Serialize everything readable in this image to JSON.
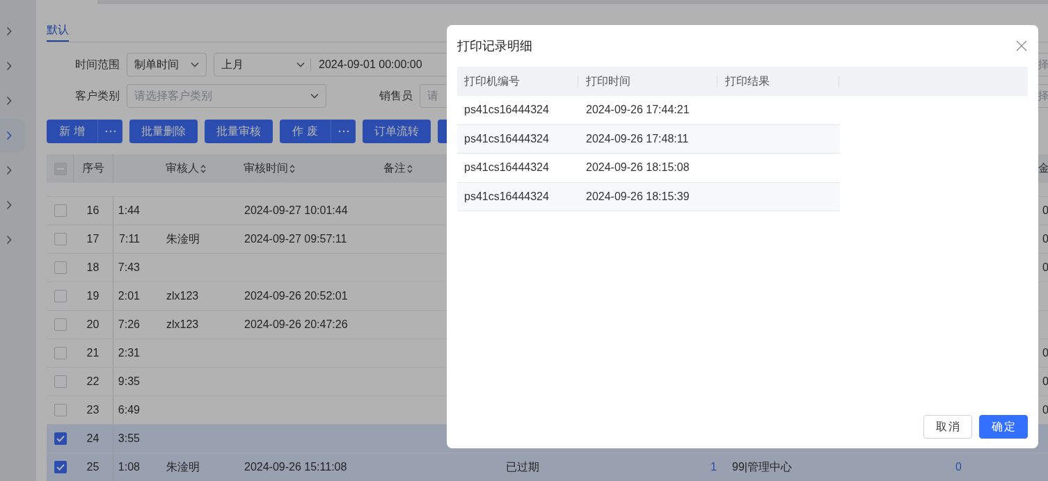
{
  "sidebar": {
    "items": [
      {
        "selected": false
      },
      {
        "selected": false
      },
      {
        "selected": false
      },
      {
        "selected": true
      },
      {
        "selected": false
      },
      {
        "selected": false
      },
      {
        "selected": false
      }
    ]
  },
  "tabs": [
    {
      "label": "默认",
      "selected": true
    }
  ],
  "filters": [
    {
      "kind": "time_range",
      "label": "时间范围",
      "field": "制单时间",
      "period": "上月",
      "date_from": "2024-09-01 00:00:00",
      "edge_placeholder": "择"
    },
    {
      "kind": "select_pair",
      "label": "客户类别",
      "placeholder": "请选择客户类别",
      "label_2": "销售员",
      "placeholder_2": "请",
      "edge_placeholder": "择"
    }
  ],
  "toolbar": [
    {
      "label": "新 增",
      "more": true
    },
    {
      "label": "批量删除",
      "more": false
    },
    {
      "label": "批量审核",
      "more": false
    },
    {
      "label": "作 废",
      "more": true
    },
    {
      "label": "订单流转",
      "more": false
    },
    {
      "more": false
    }
  ],
  "table": {
    "all_checked": false,
    "indeterminate": true,
    "columns": [
      {
        "label": "序号"
      },
      null,
      {
        "label": "审核人",
        "sortable": true
      },
      {
        "label": "审核时间",
        "sortable": true
      },
      {
        "label": "备注",
        "sortable": true
      },
      null,
      null,
      null,
      null,
      null,
      {
        "label": "金"
      }
    ],
    "rows": [
      {
        "selected": false,
        "cells": [
          "16",
          "1:44",
          null,
          "2024-09-27 10:01:44",
          null,
          null,
          null,
          null,
          null,
          null,
          "0"
        ]
      },
      {
        "selected": false,
        "cells": [
          "17",
          "7:11",
          "朱淦明",
          "2024-09-27 09:57:11",
          null,
          null,
          null,
          null,
          null,
          null,
          "0"
        ]
      },
      {
        "selected": false,
        "cells": [
          "18",
          "7:43",
          null,
          null,
          null,
          null,
          null,
          null,
          null,
          null,
          "0"
        ]
      },
      {
        "selected": false,
        "cells": [
          "19",
          "2:01",
          "zlx123",
          "2024-09-26 20:52:01",
          null,
          null,
          null,
          null,
          null,
          null,
          null
        ]
      },
      {
        "selected": false,
        "cells": [
          "20",
          "7:26",
          "zlx123",
          "2024-09-26 20:47:26",
          null,
          null,
          null,
          null,
          null,
          null,
          null
        ]
      },
      {
        "selected": false,
        "cells": [
          "21",
          "2:31",
          null,
          null,
          null,
          null,
          null,
          null,
          null,
          null,
          "0"
        ]
      },
      {
        "selected": false,
        "cells": [
          "22",
          "9:35",
          null,
          null,
          null,
          null,
          null,
          null,
          null,
          null,
          "0"
        ]
      },
      {
        "selected": false,
        "cells": [
          "23",
          "6:49",
          null,
          null,
          null,
          null,
          null,
          null,
          null,
          null,
          "0"
        ]
      },
      {
        "selected": true,
        "cells": [
          "24",
          "3:55",
          null,
          null,
          null,
          null,
          null,
          null,
          null,
          null,
          null
        ]
      },
      {
        "selected": true,
        "cells": [
          "25",
          "1:08",
          "朱淦明",
          "2024-09-26 15:11:08",
          null,
          "已过期",
          "1",
          "99|管理中心",
          "0",
          null,
          null
        ]
      }
    ]
  },
  "dialog": {
    "title": "打印记录明细",
    "columns": [
      "打印机编号",
      "打印时间",
      "打印结果"
    ],
    "rows": [
      {
        "printer": "ps41cs16444324",
        "time": "2024-09-26 17:44:21"
      },
      {
        "printer": "ps41cs16444324",
        "time": "2024-09-26 17:48:11"
      },
      {
        "printer": "ps41cs16444324",
        "time": "2024-09-26 18:15:08"
      },
      {
        "printer": "ps41cs16444324",
        "time": "2024-09-26 18:15:39"
      }
    ],
    "buttons": [
      {
        "label": "取消",
        "kind": "default"
      },
      {
        "label": "确定",
        "kind": "primary"
      }
    ]
  }
}
